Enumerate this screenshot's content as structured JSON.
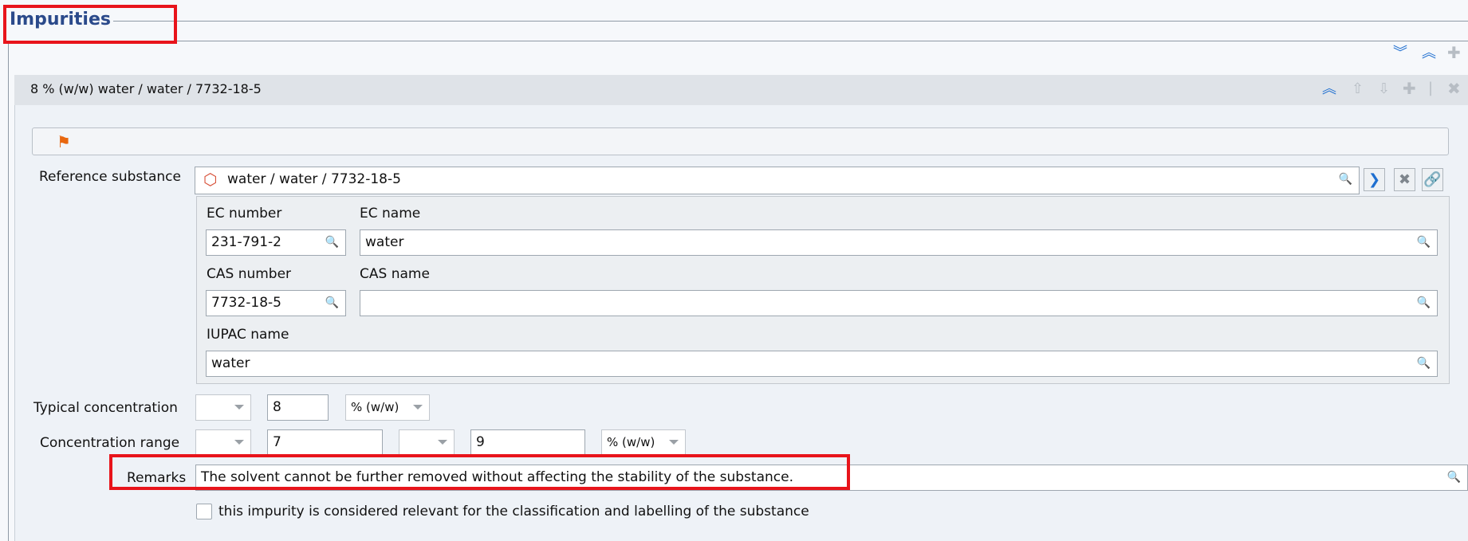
{
  "section": {
    "title": "Impurities",
    "toolbar": {
      "expand_all": "expand-all-icon",
      "collapse_all": "collapse-all-icon",
      "add": "add-icon"
    }
  },
  "entry": {
    "header": "8 % (w/w) water / water / 7732-18-5",
    "toolbar": [
      "collapse-icon",
      "move-up-icon",
      "move-down-icon",
      "add-icon",
      "delete-icon"
    ],
    "flag_icon": "flag-icon",
    "reference_substance": {
      "label": "Reference substance",
      "value": "water / water / 7732-18-5",
      "ec_number_label": "EC number",
      "ec_number": "231-791-2",
      "ec_name_label": "EC name",
      "ec_name": "water",
      "cas_number_label": "CAS number",
      "cas_number": "7732-18-5",
      "cas_name_label": "CAS name",
      "cas_name": "",
      "iupac_name_label": "IUPAC name",
      "iupac_name": "water"
    },
    "typical_concentration": {
      "label": "Typical concentration",
      "qualifier": "",
      "value": "8",
      "unit": "% (w/w)"
    },
    "concentration_range": {
      "label": "Concentration range",
      "lower_qualifier": "",
      "lower_value": "7",
      "upper_qualifier": "",
      "upper_value": "9",
      "unit": "% (w/w)"
    },
    "remarks": {
      "label": "Remarks",
      "value": "The solvent cannot be further removed without affecting the stability of the substance."
    },
    "relevance_checkbox": {
      "label": "this impurity is considered relevant for the classification and labelling of the substance",
      "checked": false
    }
  },
  "colors": {
    "highlight": "#e8141b",
    "title": "#2b4a8b",
    "accent": "#1f6fd0"
  }
}
